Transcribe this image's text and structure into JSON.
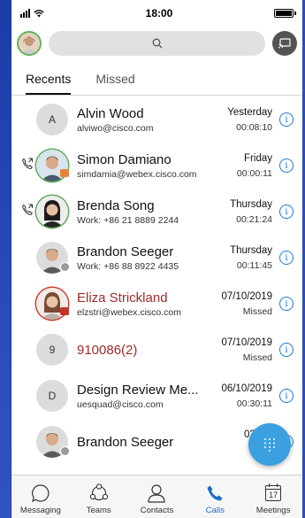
{
  "status_bar": {
    "time": "18:00"
  },
  "header": {
    "search_icon": "search-icon",
    "cast_icon": "cast-icon"
  },
  "tabs": [
    {
      "label": "Recents",
      "active": true
    },
    {
      "label": "Missed",
      "active": false
    }
  ],
  "calls": [
    {
      "name": "Alvin Wood",
      "sub": "alviwo@cisco.com",
      "date": "Yesterday",
      "detail": "00:08:10",
      "avatar": "A",
      "missed": false,
      "direction": ""
    },
    {
      "name": "Simon Damiano",
      "sub": "simdamia@webex.cisco.com",
      "date": "Friday",
      "detail": "00:00:11",
      "avatar": "photo",
      "missed": false,
      "direction": "outgoing"
    },
    {
      "name": "Brenda Song",
      "sub": "Work: +86 21 8889 2244",
      "date": "Thursday",
      "detail": "00:21:24",
      "avatar": "photo",
      "missed": false,
      "direction": "outgoing"
    },
    {
      "name": "Brandon Seeger",
      "sub": "Work: +86 88 8922 4435",
      "date": "Thursday",
      "detail": "00:11:45",
      "avatar": "photo",
      "missed": false,
      "direction": ""
    },
    {
      "name": "Eliza Strickland",
      "sub": "elzstri@webex.cisco.com",
      "date": "07/10/2019",
      "detail": "Missed",
      "avatar": "photo",
      "missed": true,
      "direction": ""
    },
    {
      "name": "910086(2)",
      "sub": "",
      "date": "07/10/2019",
      "detail": "Missed",
      "avatar": "9",
      "missed": true,
      "direction": ""
    },
    {
      "name": "Design Review Me...",
      "sub": "uesquad@cisco.com",
      "date": "06/10/2019",
      "detail": "00:30:11",
      "avatar": "D",
      "missed": false,
      "direction": ""
    },
    {
      "name": "Brandon Seeger",
      "sub": "",
      "date": "02/10/",
      "detail": "00:",
      "avatar": "photo",
      "missed": false,
      "direction": ""
    }
  ],
  "nav": [
    {
      "label": "Messaging",
      "icon": "chat-bubble-icon",
      "active": false
    },
    {
      "label": "Teams",
      "icon": "teams-icon",
      "active": false
    },
    {
      "label": "Contacts",
      "icon": "contacts-icon",
      "active": false
    },
    {
      "label": "Calls",
      "icon": "phone-icon",
      "active": true
    },
    {
      "label": "Meetings",
      "icon": "calendar-icon",
      "active": false,
      "calendar_day": "17"
    }
  ],
  "colors": {
    "accent": "#1a6fc9",
    "missed": "#a02a2a",
    "fab": "#3aa0e0",
    "presence_green": "#5aa95a",
    "presence_red": "#cc3a2a"
  }
}
